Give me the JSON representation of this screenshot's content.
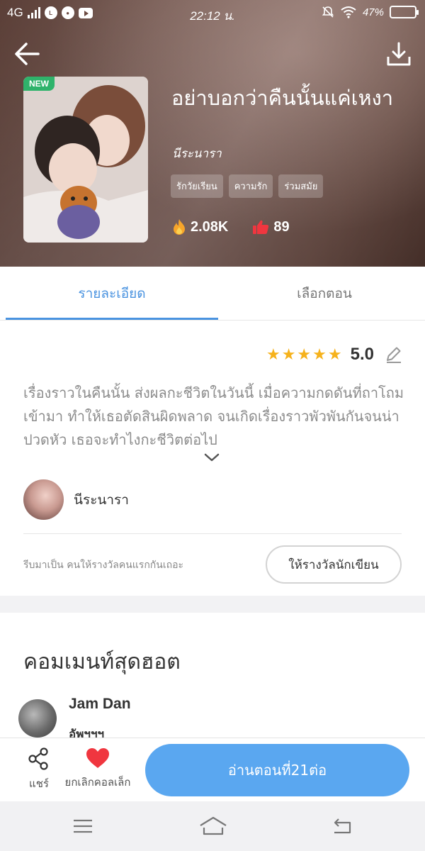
{
  "status_bar": {
    "carrier": "4G",
    "time": "22:12 น.",
    "battery": "47%",
    "battery_level": 0.47
  },
  "book": {
    "title": "อย่าบอกว่าคืนนั้นแค่เหงา",
    "author": "นีระนารา",
    "badge": "NEW",
    "tags": [
      "รักวัยเรียน",
      "ความรัก",
      "ร่วมสมัย"
    ],
    "views": "2.08K",
    "likes": "89"
  },
  "tabs": [
    "รายละเอียด",
    "เลือกตอน"
  ],
  "details": {
    "rating": "5.0",
    "stars": 5,
    "synopsis": "เรื่องราวในคืนนั้น ส่งผลกะชีวิตในวันนี้ เมื่อความกดดันที่ถาโถมเข้ามา ทำให้เธอตัดสินผิดพลาด จนเกิดเรื่องราวพัวพันกันจนน่าปวดหัว เธอจะทำไงกะชีวิตต่อไป",
    "author_name": "นีระนารา",
    "reward_text": "รีบมาเป็น คนให้รางวัลคนแรกกันเถอะ",
    "reward_button": "ให้รางวัลนักเขียน"
  },
  "comments": {
    "title": "คอมเมนท์สุดฮอต",
    "items": [
      {
        "name": "Jam Dan",
        "text": "อัพฯฯฯ"
      }
    ]
  },
  "bottom": {
    "share_label": "แชร์",
    "fav_label": "ยกเลิกคอลเล็ก",
    "read_button": "อ่านตอนที่21ต่อ"
  },
  "colors": {
    "accent": "#4a93e0",
    "read_button": "#5aa7f0",
    "star": "#f6b21c",
    "heart": "#f0363f",
    "new_badge": "#2fb36b"
  }
}
